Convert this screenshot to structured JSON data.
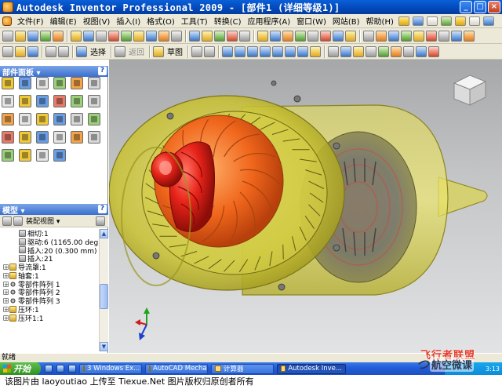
{
  "window": {
    "title": "Autodesk Inventor Professional 2009 - [部件1 (详细等级1)]",
    "btn_min": "_",
    "btn_max": "□",
    "btn_close": "×"
  },
  "menu": {
    "file": "文件(F)",
    "edit": "编辑(E)",
    "view": "视图(V)",
    "insert": "插入(I)",
    "format": "格式(O)",
    "tools": "工具(T)",
    "convert": "转换(C)",
    "apps": "应用程序(A)",
    "window": "窗口(W)",
    "web": "网站(B)",
    "help": "帮助(H)"
  },
  "toolbar": {
    "select_label": "选择",
    "return_label": "返回",
    "sketch_label": "草图"
  },
  "parts_panel": {
    "title": "部件面板 ▾",
    "help": "?"
  },
  "model_panel": {
    "title": "模型 ▾",
    "help": "?",
    "assembly_view": "装配视图 ▾"
  },
  "tree": [
    {
      "indent": 24,
      "icon": "constraint",
      "label": "相切:1"
    },
    {
      "indent": 24,
      "icon": "constraint",
      "label": "驱动:6 (1165.00 deg)"
    },
    {
      "indent": 24,
      "icon": "constraint",
      "label": "插入:20 (0.300 mm)"
    },
    {
      "indent": 24,
      "icon": "constraint",
      "label": "插入:21"
    },
    {
      "indent": 4,
      "icon": "folder",
      "label": "导流罩:1",
      "expandable": true
    },
    {
      "indent": 4,
      "icon": "folder",
      "label": "轴套:1",
      "expandable": true
    },
    {
      "indent": 4,
      "icon": "pattern",
      "label": "零部件阵列 1",
      "expandable": true
    },
    {
      "indent": 4,
      "icon": "pattern",
      "label": "零部件阵列 2",
      "expandable": true
    },
    {
      "indent": 4,
      "icon": "pattern",
      "label": "零部件阵列 3",
      "expandable": true
    },
    {
      "indent": 4,
      "icon": "folder",
      "label": "压环:1",
      "expandable": true
    },
    {
      "indent": 4,
      "icon": "folder",
      "label": "压环1:1",
      "expandable": true
    }
  ],
  "status": {
    "text": "就绪"
  },
  "taskbar": {
    "start": "开始",
    "tasks": [
      {
        "label": "3 Windows Ex...",
        "active": false
      },
      {
        "label": "AutoCAD Mecha...",
        "active": false
      },
      {
        "label": "计算器",
        "active": false
      },
      {
        "label": "Autodesk Inve...",
        "active": true
      }
    ],
    "time": "3:13"
  },
  "watermark": {
    "brand": "飞行者联盟",
    "account": "航空微课",
    "caption": "该图片由 laoyoutiao 上传至 Tiexue.Net 图片版权归原创者所有"
  },
  "colors": {
    "casing": "#d8d23a",
    "impeller": "#e8241a",
    "turbine_wheel": "#f06a1e",
    "titlebar": "#0a5fd8"
  }
}
